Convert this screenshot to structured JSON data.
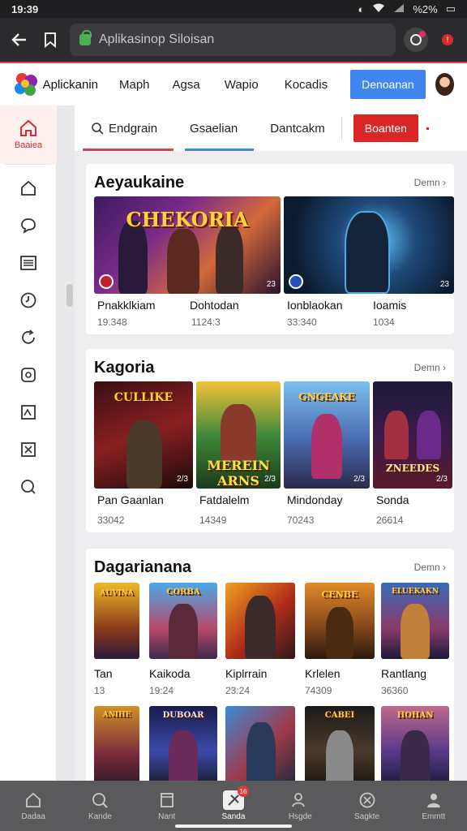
{
  "status_bar": {
    "time": "19:39",
    "battery": "%2%"
  },
  "browser": {
    "url": "Aplikasinop Siloisan"
  },
  "header": {
    "app_name": "Aplickanin",
    "nav": [
      "Maph",
      "Agsa",
      "Wapio",
      "Kocadis"
    ],
    "cta_label": "Denoanan"
  },
  "sidebar": {
    "active_label": "Baaiea"
  },
  "subnav": {
    "tabs": [
      "Endgrain",
      "Gsaelian",
      "Dantcakm"
    ],
    "button_label": "Boanten"
  },
  "sections": [
    {
      "title": "Aeyaukaine",
      "more": "Demn ›",
      "cards": [
        {
          "title": "Pnakklkiam",
          "meta": "19.348",
          "art_text": "CHEKORIA",
          "badge": "23"
        },
        {
          "title": "Dohtodan",
          "meta": "1124:3",
          "art_text": "",
          "badge": "23"
        },
        {
          "title": "Ionblaokan",
          "meta": "33:340",
          "art_text": "",
          "badge": "23"
        },
        {
          "title": "Ioamis",
          "meta": "1034",
          "art_text": "",
          "badge": "23"
        }
      ]
    },
    {
      "title": "Kagoria",
      "more": "Demn ›",
      "cards": [
        {
          "title": "Pan Gaanlan",
          "meta": "33042",
          "art_text": "CULLIKE",
          "badge": "2/3"
        },
        {
          "title": "Fatdalelm",
          "meta": "14349",
          "art_text": "MEREIN ARNS",
          "badge": "2/3"
        },
        {
          "title": "Mindonday",
          "meta": "70243",
          "art_text": "GNGEAKE",
          "badge": "2/3"
        },
        {
          "title": "Sonda",
          "meta": "26614",
          "art_text": "ZNEEDES",
          "badge": "2/3"
        }
      ]
    },
    {
      "title": "Dagarianana",
      "more": "Demn ›",
      "cards": [
        {
          "title": "Tan",
          "meta": "13",
          "art_text": "AUVINA"
        },
        {
          "title": "Kaikoda",
          "meta": "19:24",
          "art_text": "CORBA"
        },
        {
          "title": "Kiplrrain",
          "meta": "23:24",
          "art_text": ""
        },
        {
          "title": "Krlelen",
          "meta": "74309",
          "art_text": "CENBE"
        },
        {
          "title": "Rantlang",
          "meta": "36360",
          "art_text": "ELUEKAKN"
        }
      ],
      "cards_row2": [
        {
          "art_text": "ANIHE"
        },
        {
          "art_text": "DUBOAR"
        },
        {
          "art_text": ""
        },
        {
          "art_text": "CABEI"
        },
        {
          "art_text": "HOHAN"
        }
      ]
    }
  ],
  "bottom_nav": {
    "items": [
      "Dadaa",
      "Kande",
      "Nant",
      "Sanda",
      "Hsgde",
      "Sagkte",
      "Emmtt"
    ],
    "active_index": 3,
    "badge": "16"
  },
  "colors": {
    "accent_red": "#dc2626",
    "accent_blue": "#3f86f0",
    "bottom_bar": "#5a5a5c"
  }
}
